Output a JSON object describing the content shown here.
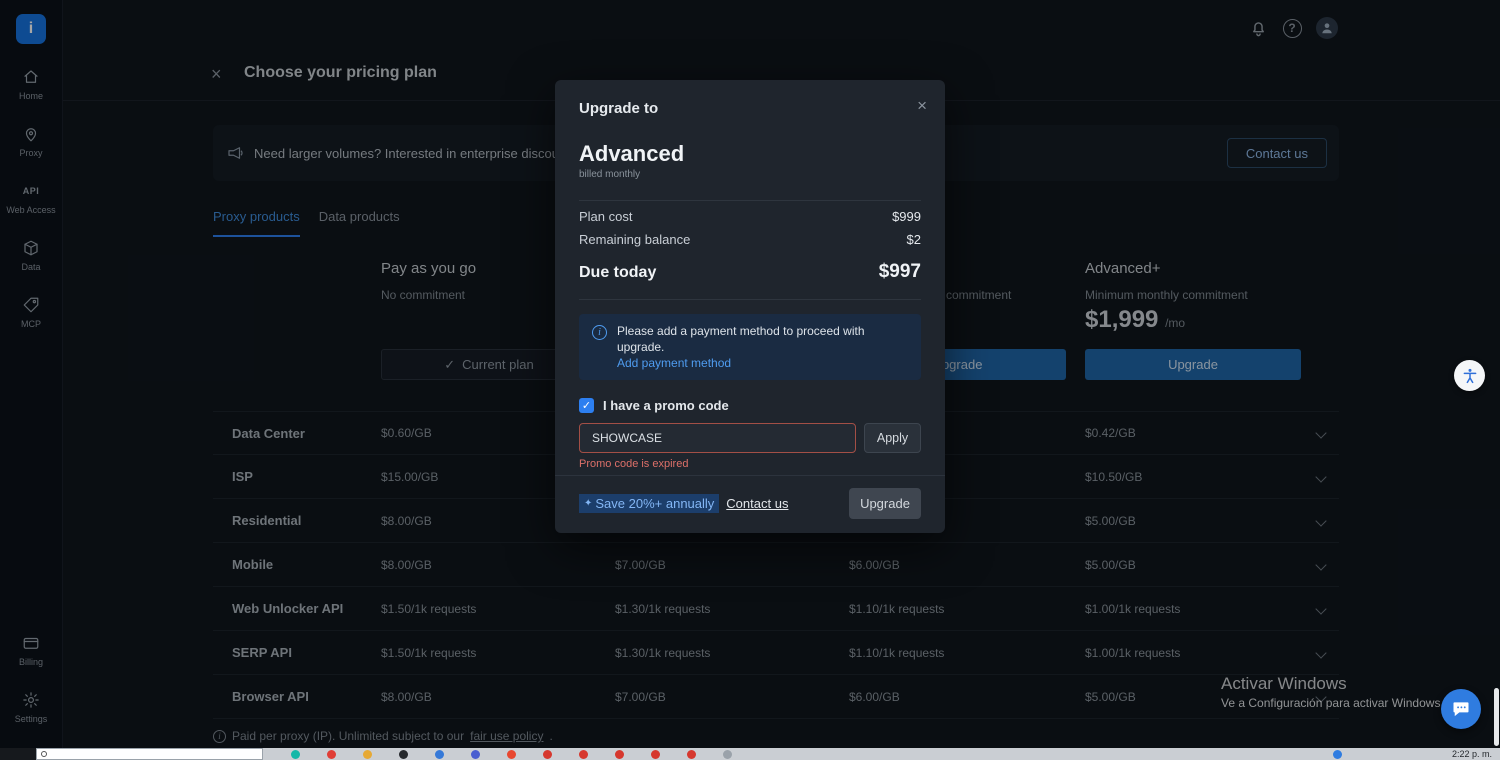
{
  "sidebar": {
    "items": [
      {
        "label": "Home"
      },
      {
        "label": "Proxy"
      },
      {
        "label": "Web Access",
        "icon_text": "API"
      },
      {
        "label": "Data"
      },
      {
        "label": "MCP"
      }
    ],
    "bottom_items": [
      {
        "label": "Billing"
      },
      {
        "label": "Settings"
      }
    ]
  },
  "page": {
    "title": "Choose your pricing plan",
    "banner": {
      "text": "Need larger volumes? Interested in enterprise discounts?",
      "button_label": "Contact us"
    },
    "tabs": [
      {
        "label": "Proxy products"
      },
      {
        "label": "Data products"
      }
    ],
    "plans": {
      "plan1": {
        "name": "Pay as you go",
        "commitment": "No commitment",
        "button_label": "Current plan"
      },
      "plan3": {
        "commitment_fragment": "commitment",
        "button_label": "Upgrade"
      },
      "plan4": {
        "name": "Advanced+",
        "commitment": "Minimum monthly commitment",
        "price": "$1,999",
        "price_period": "/mo",
        "button_label": "Upgrade"
      }
    },
    "table": {
      "rows": [
        {
          "name": "Data Center",
          "cells": [
            "$0.60/GB",
            "",
            "",
            "$0.42/GB"
          ]
        },
        {
          "name": "ISP",
          "cells": [
            "$15.00/GB",
            "",
            "",
            "$10.50/GB"
          ]
        },
        {
          "name": "Residential",
          "cells": [
            "$8.00/GB",
            "",
            "",
            "$5.00/GB"
          ]
        },
        {
          "name": "Mobile",
          "cells": [
            "$8.00/GB",
            "$7.00/GB",
            "$6.00/GB",
            "$5.00/GB"
          ]
        },
        {
          "name": "Web Unlocker API",
          "cells": [
            "$1.50/1k requests",
            "$1.30/1k requests",
            "$1.10/1k requests",
            "$1.00/1k requests"
          ]
        },
        {
          "name": "SERP API",
          "cells": [
            "$1.50/1k requests",
            "$1.30/1k requests",
            "$1.10/1k requests",
            "$1.00/1k requests"
          ]
        },
        {
          "name": "Browser API",
          "cells": [
            "$8.00/GB",
            "$7.00/GB",
            "$6.00/GB",
            "$5.00/GB"
          ]
        }
      ],
      "footnote_prefix": "Paid per proxy (IP). Unlimited subject to our",
      "footnote_link": "fair use policy",
      "footnote_suffix": "."
    }
  },
  "modal": {
    "eyebrow": "Upgrade to",
    "plan_name": "Advanced",
    "billing_cycle": "billed monthly",
    "line_items": [
      {
        "label": "Plan cost",
        "value": "$999"
      },
      {
        "label": "Remaining balance",
        "value": "$2"
      }
    ],
    "due_label": "Due today",
    "due_value": "$997",
    "payment_notice": {
      "text": "Please add a payment method to proceed with upgrade.",
      "link_label": "Add payment method"
    },
    "promo": {
      "checkbox_label": "I have a promo code",
      "code_value": "SHOWCASE",
      "apply_label": "Apply",
      "error": "Promo code is expired"
    },
    "footer": {
      "save_badge": "Save 20%+ annually",
      "contact_label": "Contact us",
      "upgrade_label": "Upgrade"
    }
  },
  "os": {
    "watermark_line1": "Activar Windows",
    "watermark_line2": "Ve a Configuración para activar Windows.",
    "taskbar_time": "2:22 p. m.",
    "taskbar_icons": [
      {
        "name": "app-teal-icon",
        "color": "#16b8a8"
      },
      {
        "name": "app-red-icon",
        "color": "#e03e36"
      },
      {
        "name": "folder-icon",
        "color": "#e6a935"
      },
      {
        "name": "app-dark-icon",
        "color": "#26292d"
      },
      {
        "name": "app-blue-icon",
        "color": "#3579d8"
      },
      {
        "name": "app-multicolor-icon",
        "color": "#4a5fd0"
      },
      {
        "name": "app-orange-icon",
        "color": "#e8472f"
      },
      {
        "name": "app-red-2-icon",
        "color": "#d6382e"
      },
      {
        "name": "app-red-3-icon",
        "color": "#d6382e"
      },
      {
        "name": "app-red-4-icon",
        "color": "#d6382e"
      },
      {
        "name": "app-red-5-icon",
        "color": "#d6382e"
      },
      {
        "name": "app-red-6-icon",
        "color": "#d6382e"
      },
      {
        "name": "file-icon",
        "color": "#9aa2aa"
      }
    ]
  },
  "colors": {
    "accent_blue": "#2d7ff0",
    "error_red": "#dd7069",
    "link_blue": "#4f9cf0"
  }
}
